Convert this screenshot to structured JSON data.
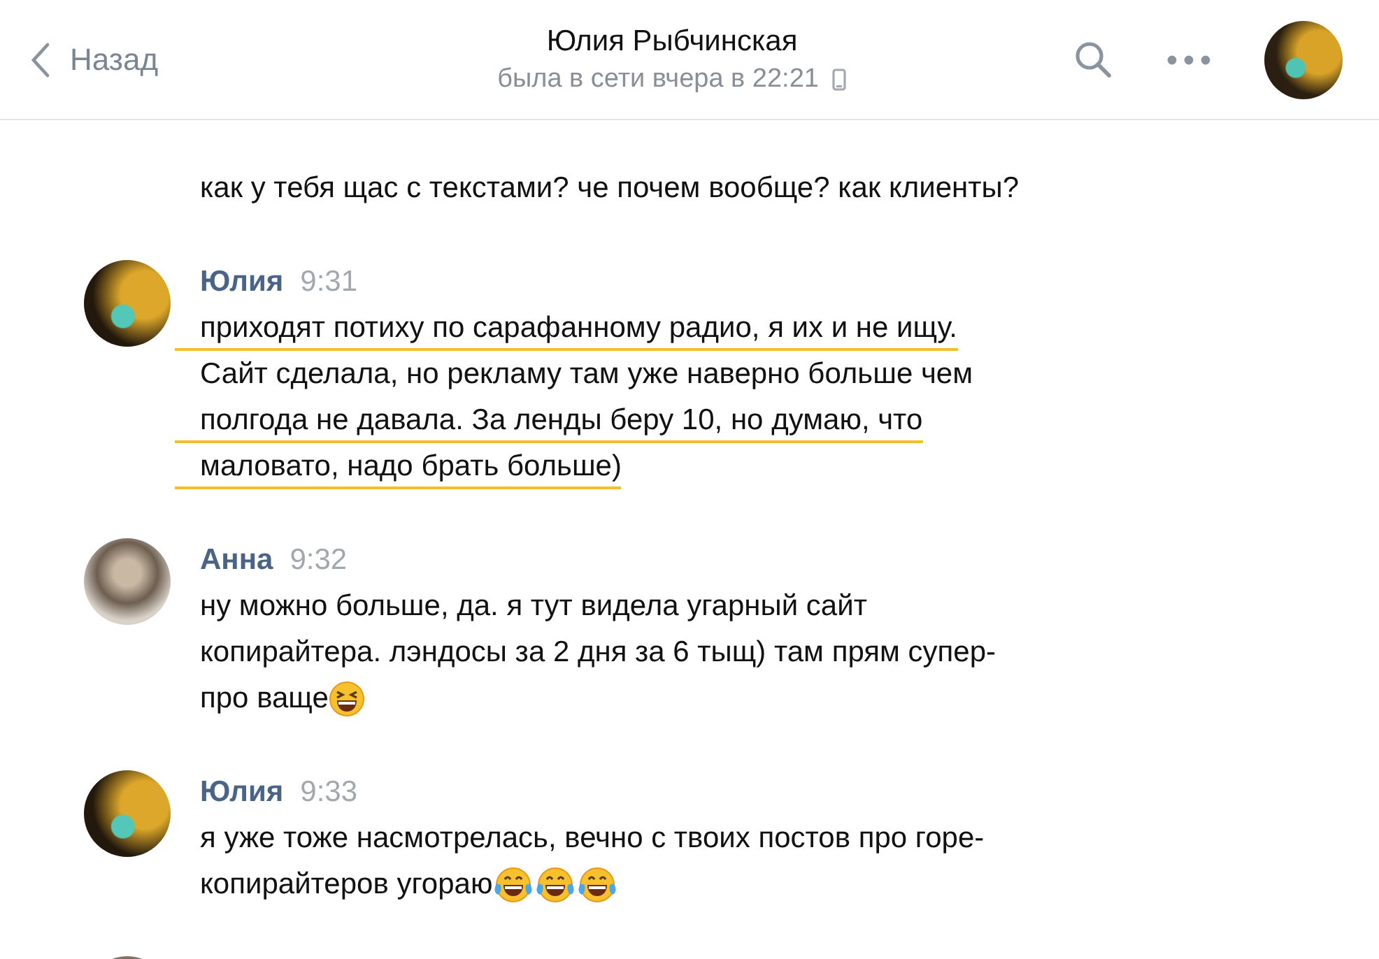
{
  "header": {
    "back_label": "Назад",
    "title": "Юлия Рыбчинская",
    "status": "была в сети вчера в 22:21"
  },
  "messages": [
    {
      "lines": [
        {
          "text": "как у тебя щас с текстами? че почем вообще? как клиенты?",
          "underlined": false
        }
      ]
    },
    {
      "author": "Юлия",
      "time": "9:31",
      "avatar": {
        "kind": "dark"
      },
      "lines": [
        {
          "text": "приходят потиху по сарафанному радио, я их и не ищу.",
          "underlined": true
        },
        {
          "text": "Сайт сделала, но рекламу там уже наверно больше чем",
          "underlined": false
        },
        {
          "text": "полгода не давала. За ленды беру 10, но думаю, что",
          "underlined": true
        },
        {
          "text": "маловато, надо брать больше)",
          "underlined": true
        }
      ]
    },
    {
      "author": "Анна",
      "time": "9:32",
      "avatar": {
        "kind": "pale"
      },
      "lines": [
        {
          "text": "ну можно больше, да. я тут видела угарный сайт",
          "underlined": false
        },
        {
          "text": "копирайтера. лэндосы за 2 дня за 6 тыщ) там прям супер-",
          "underlined": false
        },
        {
          "text": "про ваще",
          "underlined": false,
          "emojis": [
            {
              "kind": "squint"
            }
          ]
        }
      ]
    },
    {
      "author": "Юлия",
      "time": "9:33",
      "avatar": {
        "kind": "dark"
      },
      "lines": [
        {
          "text": "я уже тоже насмотрелась, вечно с твоих постов про горе-",
          "underlined": false
        },
        {
          "text": "копирайтеров угораю",
          "underlined": false,
          "emojis": [
            {
              "kind": "tears"
            },
            {
              "kind": "tears"
            },
            {
              "kind": "tears"
            }
          ]
        }
      ]
    },
    {
      "avatar": {
        "kind": "pale"
      }
    }
  ]
}
